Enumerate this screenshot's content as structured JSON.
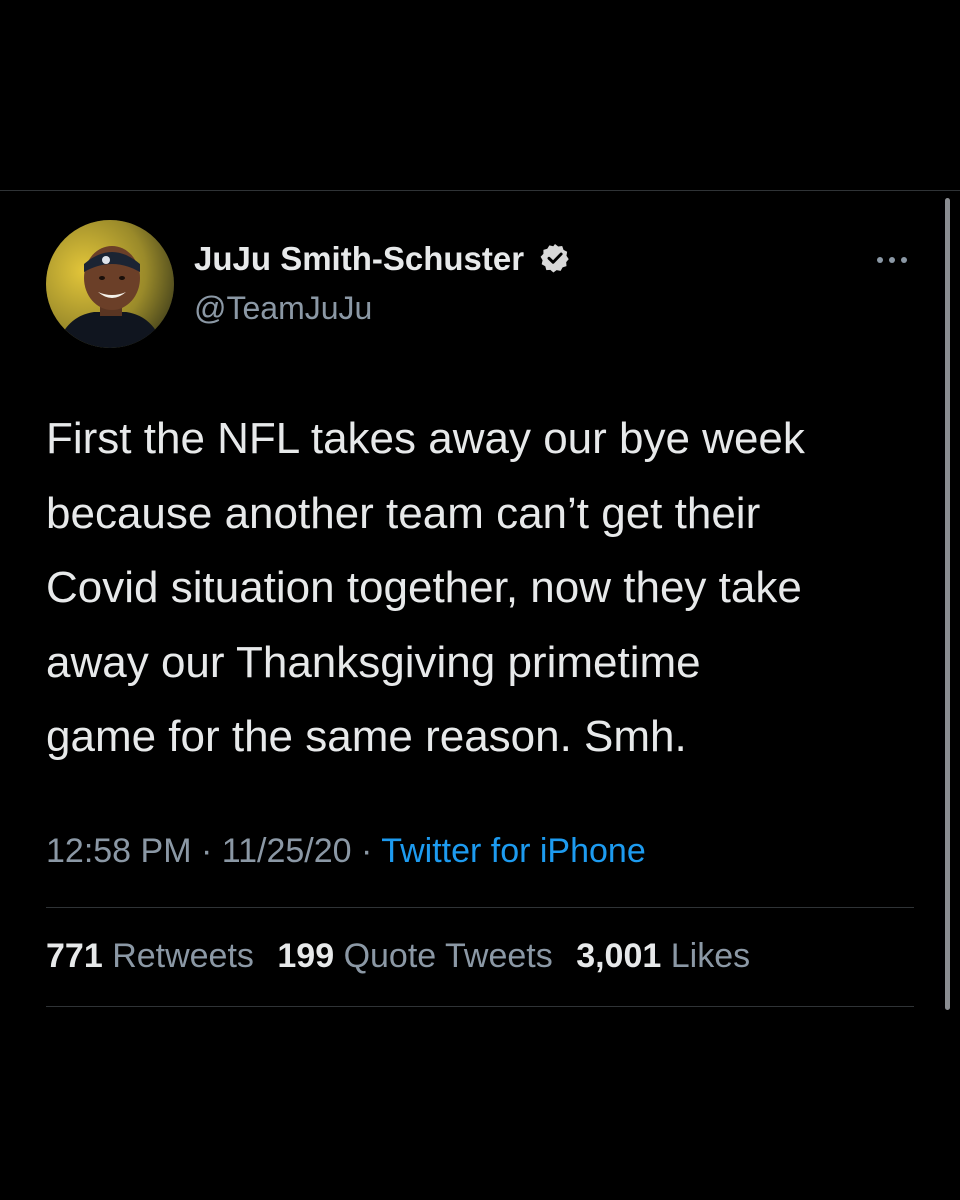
{
  "author": {
    "name": "JuJu Smith-Schuster",
    "handle": "@TeamJuJu",
    "verified": true,
    "avatar_icon": "profile-photo"
  },
  "tweet": {
    "text": "First the NFL takes away our bye week\nbecause another team can’t get their\nCovid situation together, now they take\naway our Thanksgiving primetime\ngame for the same reason. Smh."
  },
  "meta": {
    "time": "12:58 PM",
    "separator1": " · ",
    "date": "11/25/20",
    "separator2": " · ",
    "source": "Twitter for iPhone"
  },
  "stats": {
    "retweets_count": "771",
    "retweets_label": "Retweets",
    "quotes_count": "199",
    "quotes_label": "Quote Tweets",
    "likes_count": "3,001",
    "likes_label": "Likes"
  },
  "colors": {
    "background": "#000000",
    "text_primary": "#e7e9ea",
    "text_secondary": "#8b98a5",
    "link": "#1d9bf0",
    "divider": "#2f3336"
  }
}
